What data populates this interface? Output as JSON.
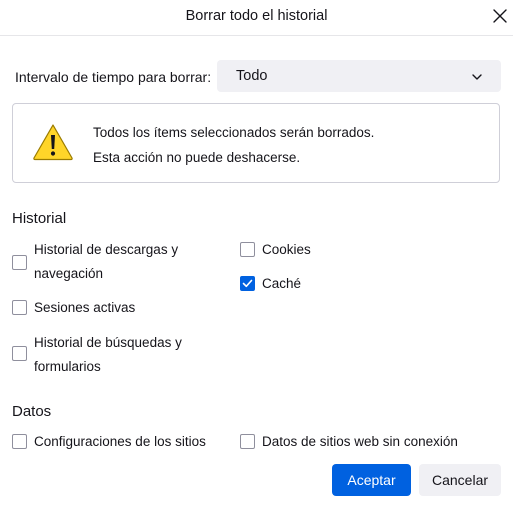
{
  "dialog": {
    "title": "Borrar todo el historial",
    "close_icon": "close-icon"
  },
  "time_range": {
    "label": "Intervalo de tiempo para borrar:",
    "selected": "Todo",
    "icon": "chevron-down-icon"
  },
  "warning": {
    "icon": "warning-icon",
    "line1": "Todos los ítems seleccionados serán borrados.",
    "line2": "Esta acción no puede deshacerse."
  },
  "history": {
    "heading": "Historial",
    "options": {
      "downloads": {
        "line1": "Historial de descargas y",
        "line2": "navegación",
        "checked": false
      },
      "sessions": {
        "label": "Sesiones activas",
        "checked": false
      },
      "search": {
        "line1": "Historial de búsquedas y",
        "line2": "formularios",
        "checked": false
      },
      "cookies": {
        "label": "Cookies",
        "checked": false
      },
      "cache": {
        "label": "Caché",
        "checked": true
      }
    }
  },
  "data": {
    "heading": "Datos",
    "options": {
      "site_settings": {
        "label": "Configuraciones de los sitios",
        "checked": false
      },
      "offline_data": {
        "label": "Datos de sitios web sin conexión",
        "checked": false
      }
    }
  },
  "buttons": {
    "accept": "Aceptar",
    "cancel": "Cancelar"
  },
  "colors": {
    "accent": "#0061e0",
    "button_bg": "#f0f0f4",
    "warning_yellow": "#ffd529"
  }
}
